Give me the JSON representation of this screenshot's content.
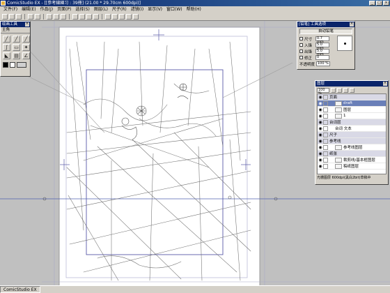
{
  "window": {
    "title": "ComicStudio EX - [[参考線練习 : 39冊] (21.00 * 29.70cm 600dpi)]",
    "controls": [
      "_",
      "□",
      "×"
    ]
  },
  "menu": [
    "文件(F)",
    "编辑(E)",
    "作品(J)",
    "页面(P)",
    "选择(S)",
    "图层(L)",
    "尺子(R)",
    "滤镜(I)",
    "显示(V)",
    "窗口(W)",
    "帮助(H)"
  ],
  "tool_palette": {
    "title": "绘画工具",
    "tab": "主角",
    "tools": [
      "pen-tool-icon",
      "pencil-tool-icon",
      "marker-tool-icon",
      "brush-tool-icon",
      "eraser-tool-icon",
      "airbrush-tool-icon",
      "fill-tool-icon",
      "gradient-tool-icon",
      "line-tool-icon"
    ],
    "tool_glyphs": [
      "╱",
      "╱",
      "╱",
      "∫",
      "▭",
      "✦",
      "◣",
      "▤",
      "∠"
    ],
    "colors": {
      "main": "#000000",
      "sub": "#ffffff",
      "bg": "#d0d0d0"
    }
  },
  "tool_options": {
    "title": "[铅笔] 工具选项",
    "preset": "自动铅笔",
    "rows": [
      {
        "label": "尺寸",
        "value": "0.7 mm",
        "checked": false
      },
      {
        "label": "入锋",
        "value": "5.0 mm",
        "checked": false
      },
      {
        "label": "出锋",
        "value": "5.0 mm",
        "checked": false
      },
      {
        "label": "修正",
        "value": "0",
        "checked": false
      },
      {
        "label": "不透明度",
        "value": "100 %",
        "checked": false
      }
    ]
  },
  "layers": {
    "title": "图层",
    "zoom": "100 %",
    "items": [
      {
        "name": "页面",
        "type": "folder",
        "active": false
      },
      {
        "name": "draft",
        "type": "layer",
        "active": true
      },
      {
        "name": "图层",
        "type": "layer",
        "active": false
      },
      {
        "name": "1",
        "type": "layer",
        "active": false
      },
      {
        "name": "台词层",
        "type": "folder",
        "active": false
      },
      {
        "name": "台词 文本",
        "type": "layer",
        "active": false
      },
      {
        "name": "尺子",
        "type": "folder",
        "active": false
      },
      {
        "name": "参考线",
        "type": "folder",
        "active": false
      },
      {
        "name": "参考线图层",
        "type": "layer",
        "active": false
      },
      {
        "name": "纸张",
        "type": "folder",
        "active": false
      },
      {
        "name": "裁剪线/基本框图层",
        "type": "layer",
        "active": false
      },
      {
        "name": "稿纸图层",
        "type": "layer",
        "active": false
      }
    ],
    "status": "光栅图层 600dpi(黑白2bit)草稿中"
  },
  "status_bar": {
    "left": "ComicStudio EX"
  }
}
